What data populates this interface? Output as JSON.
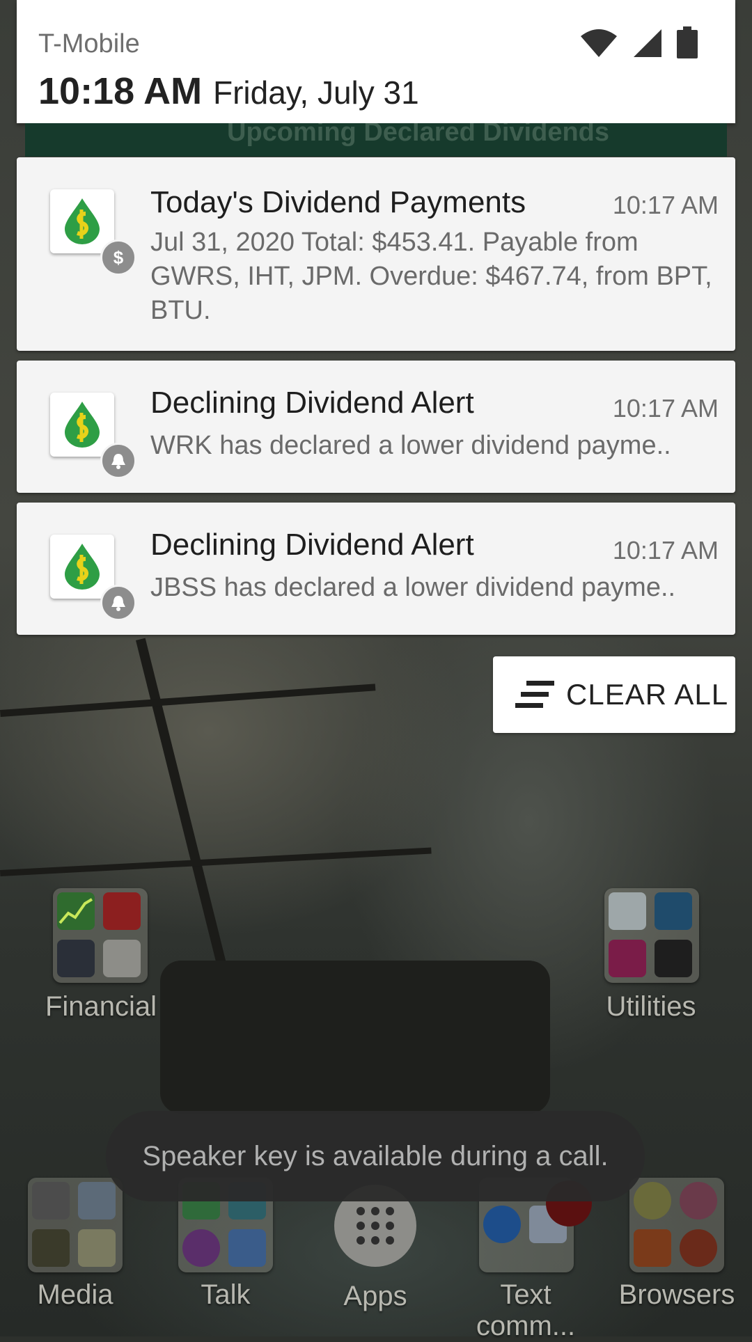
{
  "status_bar": {
    "carrier": "T-Mobile",
    "time": "10:18 AM",
    "date": "Friday, July 31",
    "icons": [
      "wifi-icon",
      "cellular-signal-icon",
      "battery-icon"
    ]
  },
  "hidden_card_title": "Upcoming Declared Dividends",
  "notifications": [
    {
      "title": "Today's Dividend Payments",
      "time": "10:17 AM",
      "body": "Jul 31, 2020 Total: $453.41. Payable from GWRS, IHT, JPM. Overdue: $467.74, from BPT, BTU.",
      "badge": "dollar-icon"
    },
    {
      "title": "Declining Dividend Alert",
      "time": "10:17 AM",
      "body": "WRK has declared a lower dividend payme..",
      "badge": "bell-icon"
    },
    {
      "title": "Declining Dividend Alert",
      "time": "10:17 AM",
      "body": "JBSS has declared a lower dividend payme..",
      "badge": "bell-icon"
    }
  ],
  "clear_all_label": "CLEAR ALL",
  "home_folders": {
    "financial": "Financial",
    "utilities": "Utilities"
  },
  "toast": "Speaker key is available during a call.",
  "dock": {
    "media": "Media",
    "talk": "Talk",
    "apps": "Apps",
    "text": "Text comm...",
    "browsers": "Browsers"
  },
  "colors": {
    "app_green": "#2e9e45",
    "app_yellow": "#e8d21a"
  }
}
